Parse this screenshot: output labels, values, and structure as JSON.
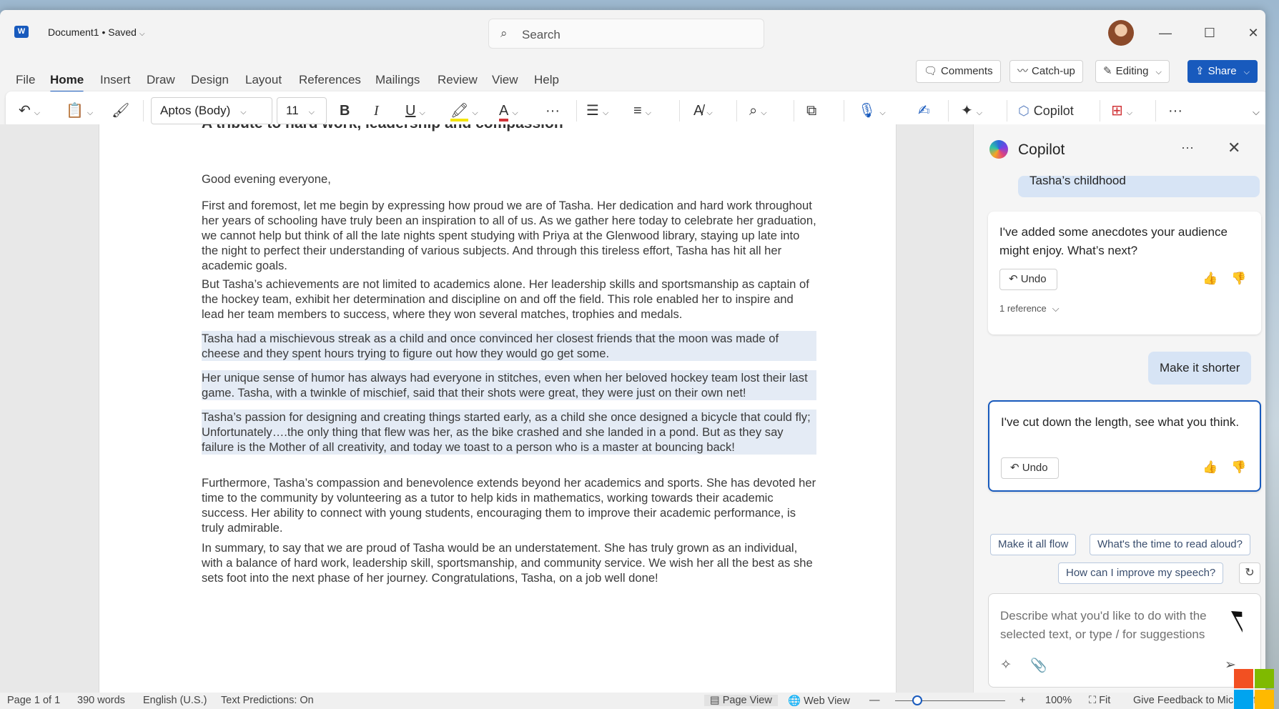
{
  "titlebar": {
    "app_icon": "W",
    "doc_title": "Document1 • Saved",
    "search_placeholder": "Search",
    "minimize": "—",
    "maximize": "☐",
    "close": "✕"
  },
  "menu": {
    "tabs": [
      "File",
      "Home",
      "Insert",
      "Draw",
      "Design",
      "Layout",
      "References",
      "Mailings",
      "Review",
      "View",
      "Help"
    ],
    "active_tab": "Home",
    "comments_label": "Comments",
    "catchup_label": "Catch-up",
    "editing_label": "Editing",
    "share_label": "Share"
  },
  "ribbon": {
    "font_name": "Aptos (Body)",
    "font_size": "11",
    "bold": "B",
    "italic": "I",
    "underline": "U",
    "copilot_label": "Copilot",
    "more": "···"
  },
  "document": {
    "heading": "A tribute to hard work, leadership and compassion",
    "paragraphs": [
      "Good evening everyone,",
      "First and foremost, let me begin by expressing how proud we are of Tasha. Her dedication and hard work throughout her years of schooling have truly been an inspiration to all of us. As we gather here today to celebrate her graduation, we cannot help but think of all the late nights spent studying with Priya at the Glenwood library, staying up late into the night to perfect their understanding of various subjects. And through this tireless effort, Tasha has hit all her academic goals.",
      "But Tasha’s achievements are not limited to academics alone. Her leadership skills and sportsmanship as captain of the hockey team, exhibit her determination and discipline on and off the field. This role enabled her to inspire and lead her team members to success, where they won several matches, trophies and medals.",
      "Tasha had a mischievous streak as a child and once convinced her closest friends that the moon was made of cheese and they spent hours trying to figure out how they would go get some.",
      "Her unique sense of humor has always had everyone in stitches, even when her beloved hockey team lost their last game. Tasha, with a twinkle of mischief, said that their shots were great, they were just on their own net!",
      "Tasha’s passion for designing and creating things started early, as a child she once designed a bicycle that could fly; Unfortunately….the only thing that flew was her, as the bike crashed and she landed in a pond. But as they say failure is the Mother of all creativity, and today we toast to a person who is a master at bouncing back!",
      "Furthermore, Tasha’s compassion and benevolence extends beyond her academics and sports. She has devoted her time to the community by volunteering as a tutor to help kids in mathematics, working towards their academic success. Her ability to connect with young students, encouraging them to improve their academic performance, is truly admirable.",
      "In summary, to say that we are proud of Tasha would be an understatement. She has truly grown as an individual, with a balance of hard work, leadership skill, sportsmanship, and community service. We wish her all the best as she sets foot into the next phase of her journey. Congratulations, Tasha, on a job well done!"
    ]
  },
  "copilot": {
    "title": "Copilot",
    "prev_user_msg": "Tasha’s childhood",
    "reply1": "I've added some anecdotes your audience might enjoy. What’s next?",
    "undo": "Undo",
    "reference": "1 reference",
    "user_msg": "Make it shorter",
    "reply2": "I've cut down the length, see what you think.",
    "suggestions": [
      "Make it all flow",
      "What's the time to read aloud?",
      "How can I improve my speech?"
    ],
    "composer_placeholder": "Describe what you'd like to do with the selected text, or type / for suggestions"
  },
  "statusbar": {
    "page": "Page 1 of 1",
    "words": "390 words",
    "language": "English (U.S.)",
    "predictions": "Text Predictions: On",
    "page_view": "Page View",
    "web_view": "Web View",
    "zoom": "100%",
    "zoom_level": 0.2,
    "fit": "Fit",
    "feedback": "Give Feedback to Microsoft"
  },
  "colors": {
    "accent": "#185abd",
    "highlight": "#e4ebf5",
    "user_bubble": "#d7e4f5"
  }
}
